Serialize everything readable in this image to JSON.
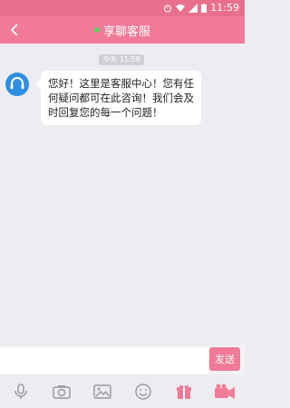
{
  "status_bar": {
    "time": "11:59"
  },
  "header": {
    "title": "享聊客服"
  },
  "chat": {
    "timestamp": "今天 11:58",
    "messages": [
      {
        "text": "您好！这里是客服中心！您有任何疑问都可在此咨询！我们会及时回复您的每一个问题！"
      }
    ]
  },
  "input": {
    "send_label": "发送"
  },
  "toolbar": {
    "items": [
      {
        "icon": "microphone-icon"
      },
      {
        "icon": "camera-icon"
      },
      {
        "icon": "image-icon"
      },
      {
        "icon": "emoji-icon"
      },
      {
        "icon": "gift-icon"
      },
      {
        "icon": "video-call-icon"
      }
    ]
  },
  "colors": {
    "primary": "#f07a97",
    "status_bar": "#e8708d",
    "online_dot": "#5fd25f",
    "avatar": "#2f8fe0"
  }
}
